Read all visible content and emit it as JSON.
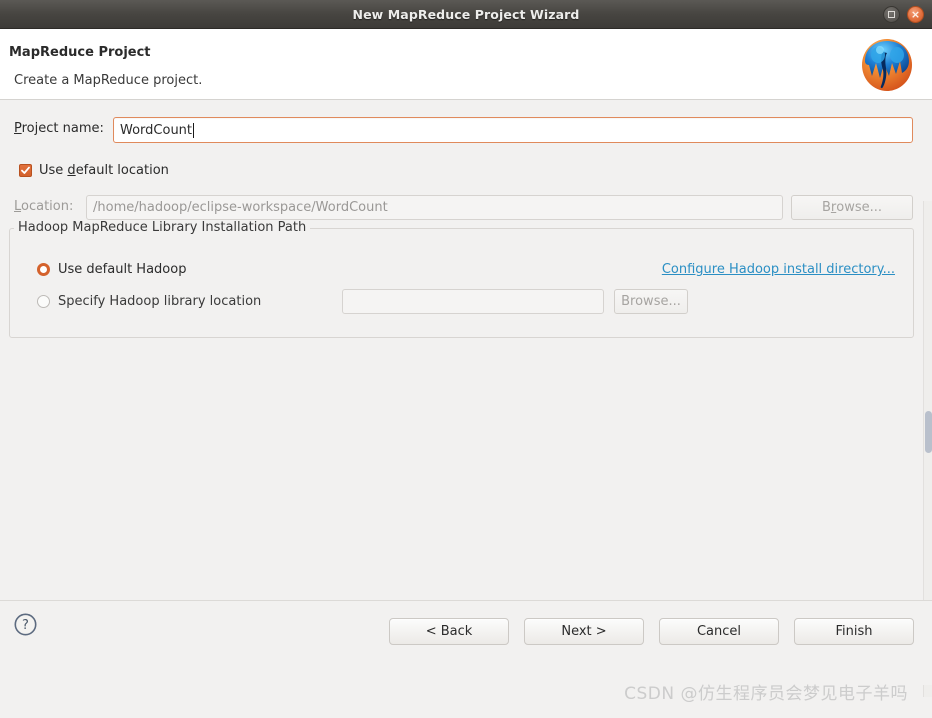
{
  "window": {
    "title": "New MapReduce Project Wizard",
    "buttons": {
      "maximize": "maximize",
      "close": "×"
    }
  },
  "header": {
    "title": "MapReduce Project",
    "description": "Create a MapReduce project.",
    "icon": "hadoop-elephant-logo"
  },
  "form": {
    "project_name": {
      "label": "Project name:",
      "label_mnemonic": "P",
      "value": "WordCount"
    },
    "use_default_location": {
      "label_before": "Use ",
      "label_mnemonic": "d",
      "label_after": "efault location",
      "checked": true
    },
    "location": {
      "label": "Location:",
      "label_mnemonic": "L",
      "value": "/home/hadoop/eclipse-workspace/WordCount",
      "enabled": false
    },
    "browse_location": {
      "label_before": "B",
      "label_mnemonic": "r",
      "label_after": "owse...",
      "enabled": false
    }
  },
  "group": {
    "title": "Hadoop MapReduce Library Installation Path",
    "radio_default": {
      "label": "Use default Hadoop",
      "selected": true
    },
    "radio_specify": {
      "label": "Specify Hadoop library location",
      "selected": false
    },
    "configure_link": "Configure Hadoop install directory...",
    "library_location_value": "",
    "browse_library": {
      "label": "Browse...",
      "enabled": false
    }
  },
  "footer": {
    "help": "?",
    "back": "< Back",
    "next": "Next >",
    "cancel": "Cancel",
    "finish": "Finish"
  },
  "watermark": "CSDN @仿生程序员会梦见电子羊吗",
  "colors": {
    "accent_orange": "#d4622c",
    "link_blue": "#2b8fc4",
    "titlebar_dark": "#474541",
    "close_button": "#e3713f",
    "window_bg": "#f2f1f0"
  }
}
